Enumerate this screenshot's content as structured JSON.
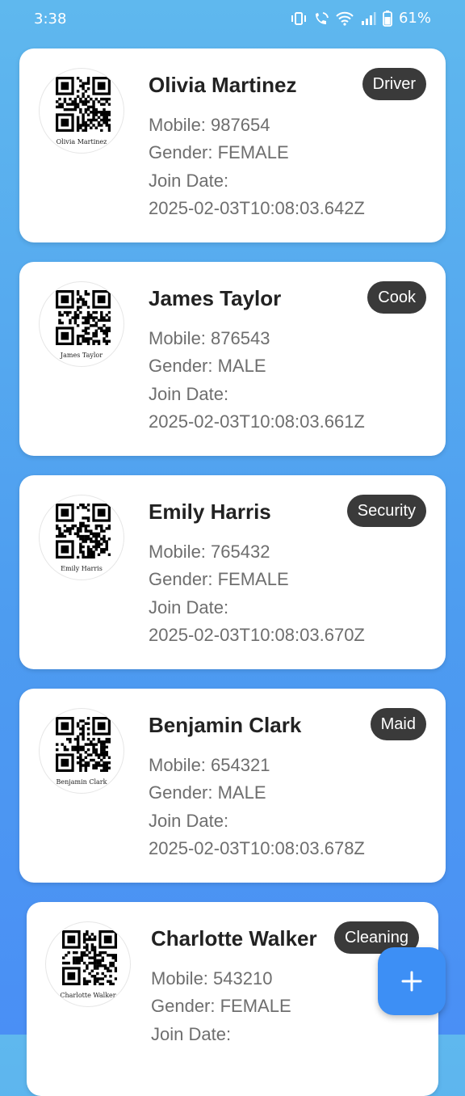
{
  "status_bar": {
    "time": "3:38",
    "battery": "61%"
  },
  "employees": [
    {
      "name": "Olivia Martinez",
      "role": "Driver",
      "mobile": "Mobile: 987654",
      "gender": "Gender: FEMALE",
      "join_label": "Join Date:",
      "join_date": "2025-02-03T10:08:03.642Z",
      "qr_caption": "Olivia Martinez"
    },
    {
      "name": "James Taylor",
      "role": "Cook",
      "mobile": "Mobile: 876543",
      "gender": "Gender: MALE",
      "join_label": "Join Date:",
      "join_date": "2025-02-03T10:08:03.661Z",
      "qr_caption": "James Taylor"
    },
    {
      "name": "Emily Harris",
      "role": "Security",
      "mobile": "Mobile: 765432",
      "gender": "Gender: FEMALE",
      "join_label": "Join Date:",
      "join_date": "2025-02-03T10:08:03.670Z",
      "qr_caption": "Emily Harris"
    },
    {
      "name": "Benjamin Clark",
      "role": "Maid",
      "mobile": "Mobile: 654321",
      "gender": "Gender: MALE",
      "join_label": "Join Date:",
      "join_date": "2025-02-03T10:08:03.678Z",
      "qr_caption": "Benjamin Clark"
    },
    {
      "name": "Charlotte Walker",
      "role": "Cleaning",
      "mobile": "Mobile: 543210",
      "gender": "Gender: FEMALE",
      "join_label": "Join Date:",
      "join_date": "",
      "qr_caption": "Charlotte Walker"
    }
  ],
  "fab": {
    "icon": "plus-icon"
  }
}
